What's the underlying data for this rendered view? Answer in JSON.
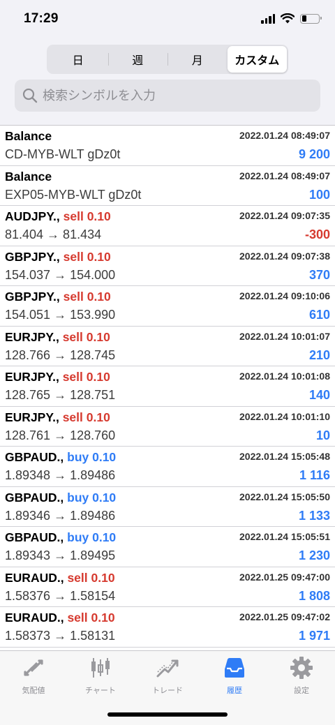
{
  "status_bar": {
    "time": "17:29"
  },
  "period_tabs": [
    {
      "label": "日",
      "active": false
    },
    {
      "label": "週",
      "active": false
    },
    {
      "label": "月",
      "active": false
    },
    {
      "label": "カスタム",
      "active": true
    }
  ],
  "search": {
    "placeholder": "検索シンボルを入力"
  },
  "history": [
    {
      "title": "Balance",
      "side": "",
      "date": "2022.01.24 08:49:07",
      "desc": "CD-MYB-WLT gDz0t",
      "profit": "9 200",
      "profit_sign": "pos"
    },
    {
      "title": "Balance",
      "side": "",
      "date": "2022.01.24 08:49:07",
      "desc": "EXP05-MYB-WLT gDz0t",
      "profit": "100",
      "profit_sign": "pos"
    },
    {
      "title": "AUDJPY., ",
      "side": "sell 0.10",
      "side_type": "sell",
      "date": "2022.01.24 09:07:35",
      "desc": "81.404 → 81.434",
      "profit": "-300",
      "profit_sign": "neg"
    },
    {
      "title": "GBPJPY., ",
      "side": "sell 0.10",
      "side_type": "sell",
      "date": "2022.01.24 09:07:38",
      "desc": "154.037 → 154.000",
      "profit": "370",
      "profit_sign": "pos"
    },
    {
      "title": "GBPJPY., ",
      "side": "sell 0.10",
      "side_type": "sell",
      "date": "2022.01.24 09:10:06",
      "desc": "154.051 → 153.990",
      "profit": "610",
      "profit_sign": "pos"
    },
    {
      "title": "EURJPY., ",
      "side": "sell 0.10",
      "side_type": "sell",
      "date": "2022.01.24 10:01:07",
      "desc": "128.766 → 128.745",
      "profit": "210",
      "profit_sign": "pos"
    },
    {
      "title": "EURJPY., ",
      "side": "sell 0.10",
      "side_type": "sell",
      "date": "2022.01.24 10:01:08",
      "desc": "128.765 → 128.751",
      "profit": "140",
      "profit_sign": "pos"
    },
    {
      "title": "EURJPY., ",
      "side": "sell 0.10",
      "side_type": "sell",
      "date": "2022.01.24 10:01:10",
      "desc": "128.761 → 128.760",
      "profit": "10",
      "profit_sign": "pos"
    },
    {
      "title": "GBPAUD., ",
      "side": "buy 0.10",
      "side_type": "buy",
      "date": "2022.01.24 15:05:48",
      "desc": "1.89348 → 1.89486",
      "profit": "1 116",
      "profit_sign": "pos"
    },
    {
      "title": "GBPAUD., ",
      "side": "buy 0.10",
      "side_type": "buy",
      "date": "2022.01.24 15:05:50",
      "desc": "1.89346 → 1.89486",
      "profit": "1 133",
      "profit_sign": "pos"
    },
    {
      "title": "GBPAUD., ",
      "side": "buy 0.10",
      "side_type": "buy",
      "date": "2022.01.24 15:05:51",
      "desc": "1.89343 → 1.89495",
      "profit": "1 230",
      "profit_sign": "pos"
    },
    {
      "title": "EURAUD., ",
      "side": "sell 0.10",
      "side_type": "sell",
      "date": "2022.01.25 09:47:00",
      "desc": "1.58376 → 1.58154",
      "profit": "1 808",
      "profit_sign": "pos"
    },
    {
      "title": "EURAUD., ",
      "side": "sell 0.10",
      "side_type": "sell",
      "date": "2022.01.25 09:47:02",
      "desc": "1.58373 → 1.58131",
      "profit": "1 971",
      "profit_sign": "pos"
    }
  ],
  "tab_bar": [
    {
      "label": "気配値",
      "icon": "quotes-arrows-icon",
      "active": false
    },
    {
      "label": "チャート",
      "icon": "candlestick-chart-icon",
      "active": false
    },
    {
      "label": "トレード",
      "icon": "trade-line-icon",
      "active": false
    },
    {
      "label": "履歴",
      "icon": "history-inbox-icon",
      "active": true
    },
    {
      "label": "設定",
      "icon": "settings-gear-icon",
      "active": false
    }
  ],
  "colors": {
    "accent": "#2f7cf6",
    "sell": "#d63a2f",
    "buy": "#2f7cf6",
    "loss": "#d63a2f"
  }
}
